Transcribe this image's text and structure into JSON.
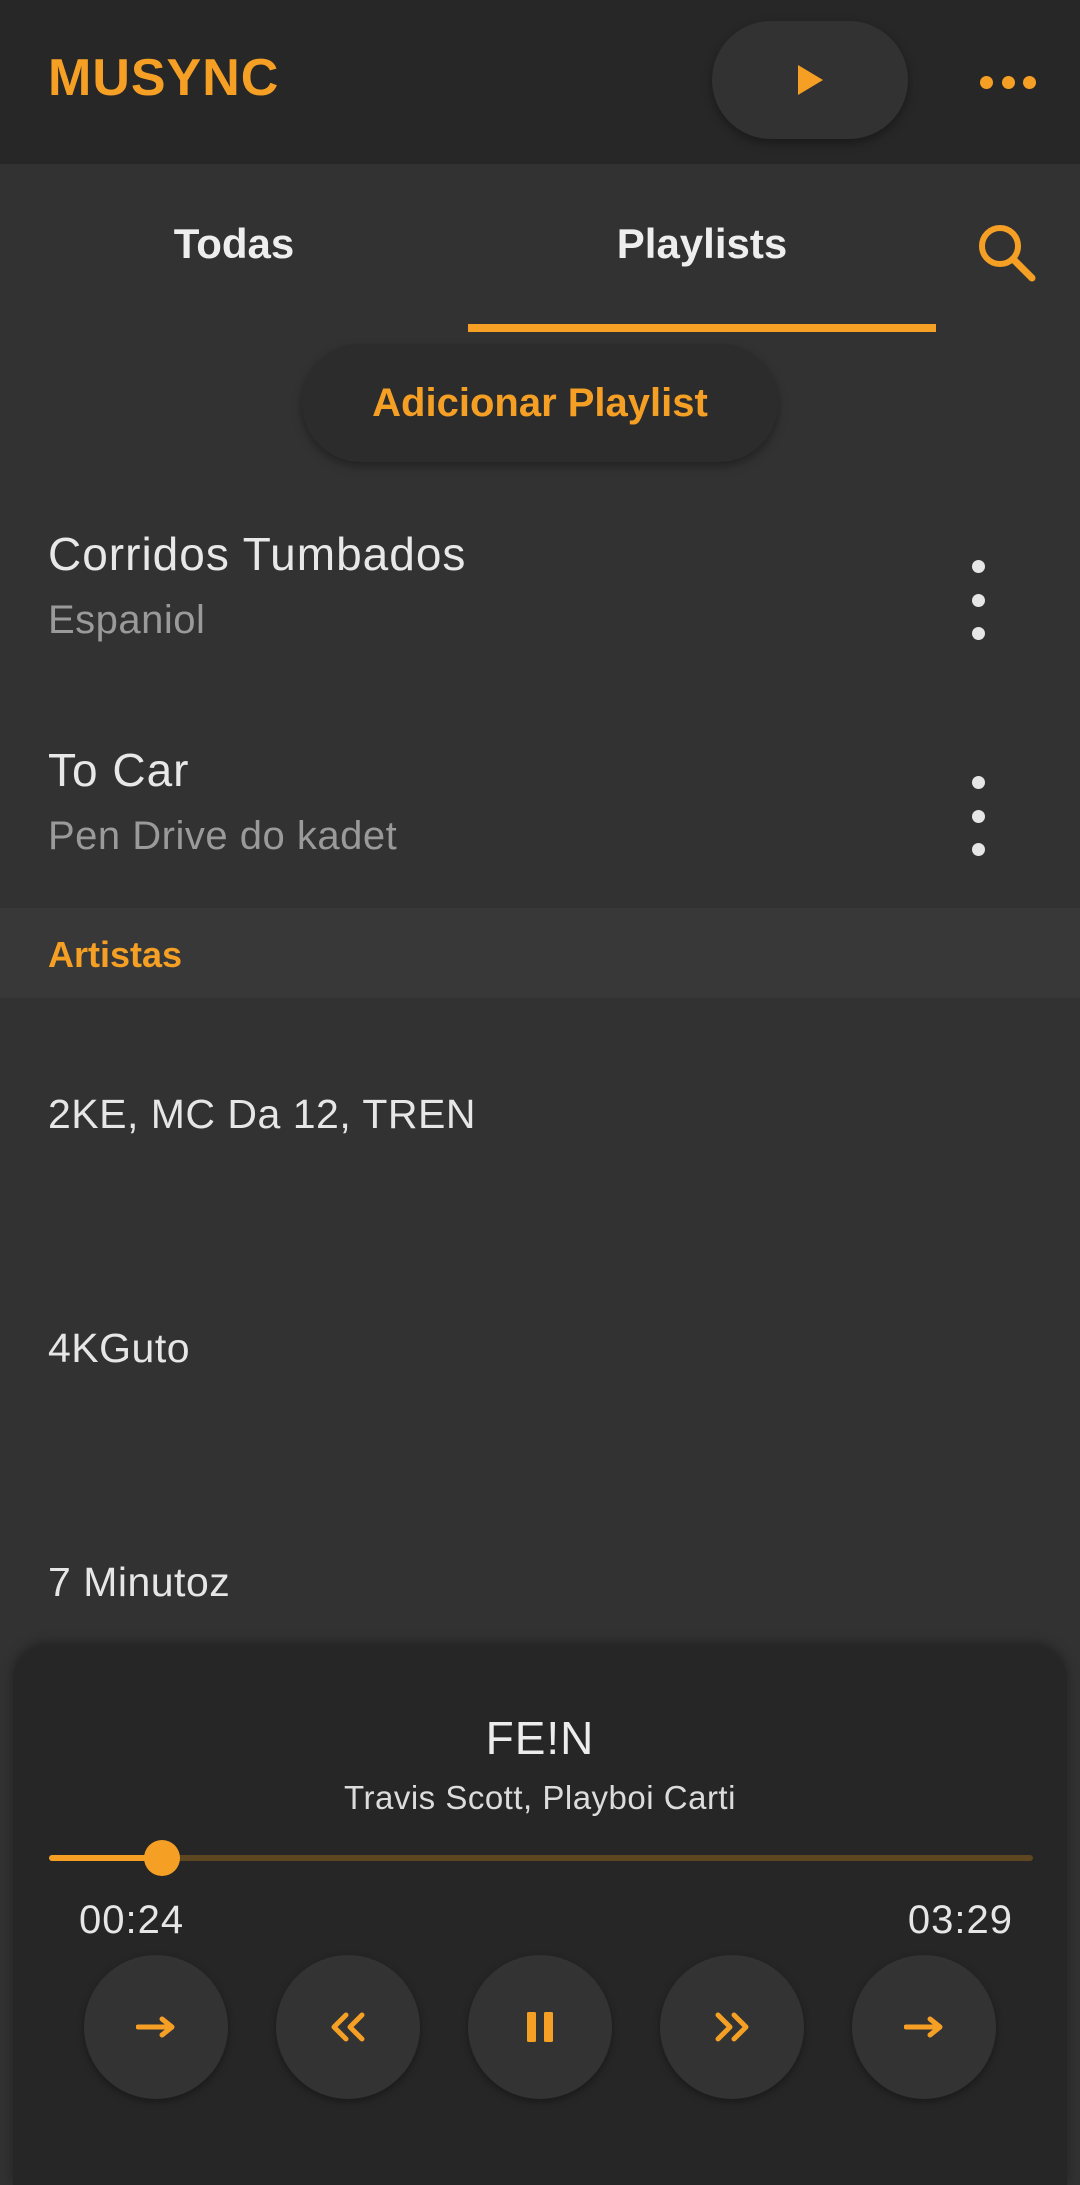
{
  "app": {
    "title": "MUSYNC"
  },
  "header": {
    "play_icon": "play-icon",
    "more_icon": "more-horizontal-icon"
  },
  "tabs": [
    {
      "label": "Todas",
      "selected": false
    },
    {
      "label": "Playlists",
      "selected": true
    }
  ],
  "search": {
    "icon": "search-icon"
  },
  "add_playlist_label": "Adicionar Playlist",
  "playlists": [
    {
      "title": "Corridos Tumbados",
      "subtitle": "Espaniol"
    },
    {
      "title": "To Car",
      "subtitle": "Pen Drive do kadet"
    }
  ],
  "artists_section": {
    "label": "Artistas"
  },
  "artists": [
    "2KE, MC Da 12, TREN",
    "4KGuto",
    "7 Minutoz"
  ],
  "player": {
    "song_title": "FE!N",
    "song_artist": "Travis Scott, Playboi Carti",
    "elapsed": "00:24",
    "total": "03:29",
    "progress_fraction": 0.115,
    "controls": [
      "arrow-right-icon",
      "rewind-icon",
      "pause-icon",
      "fast-forward-icon",
      "arrow-right-icon"
    ]
  },
  "colors": {
    "accent": "#f5a025",
    "background": "#323232",
    "topbar": "#272727",
    "player": "#262626"
  }
}
